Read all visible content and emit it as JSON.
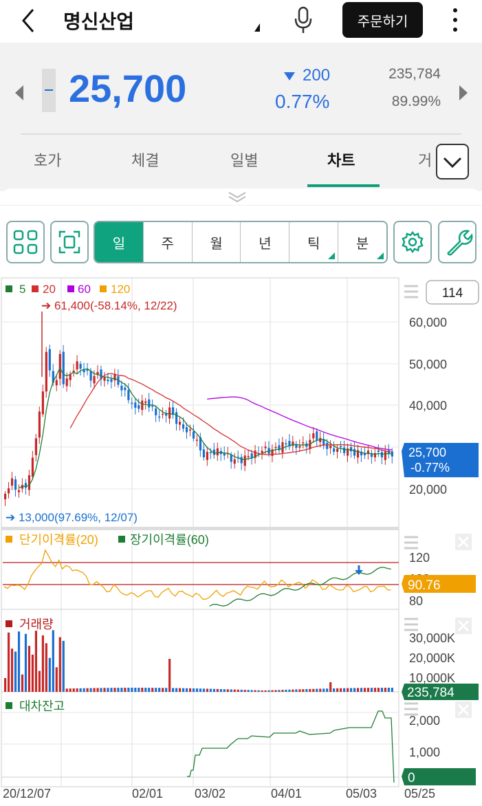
{
  "header": {
    "title": "명신산업",
    "order_label": "주문하기"
  },
  "quote": {
    "price": "25,700",
    "change": "200",
    "change_rate": "0.77%",
    "volume": "235,784",
    "volume_rate": "89.99%"
  },
  "tabs": [
    {
      "label": "호가"
    },
    {
      "label": "체결"
    },
    {
      "label": "일별"
    },
    {
      "label": "차트"
    },
    {
      "label": "거"
    }
  ],
  "active_tab": "차트",
  "periods": [
    "일",
    "주",
    "월",
    "년",
    "틱",
    "분"
  ],
  "chart": {
    "legend": [
      {
        "label": "5",
        "color": "#1e7d32"
      },
      {
        "label": "20",
        "color": "#d32f2f"
      },
      {
        "label": "60",
        "color": "#b000e0"
      },
      {
        "label": "120",
        "color": "#f0a000"
      }
    ],
    "count_box": "114",
    "max_annotation": "61,400(-58.14%, 12/22)",
    "min_annotation": "13,000(97.69%, 12/07)",
    "current_price_label": "25,700",
    "current_rate_label": "-0.77%",
    "price_ticks": [
      "60,000",
      "50,000",
      "40,000",
      "20,000"
    ],
    "disparity": {
      "legend": [
        {
          "label": "단기이격률(20)",
          "color": "#f0a000"
        },
        {
          "label": "장기이격률(60)",
          "color": "#1e7d32"
        }
      ],
      "ticks": [
        "120",
        "100",
        "80"
      ],
      "value_label": "90.76"
    },
    "volume": {
      "legend": "거래량",
      "ticks": [
        "30,000K",
        "20,000K",
        "10,000K"
      ],
      "value_label": "235,784"
    },
    "loan": {
      "legend": "대차잔고",
      "ticks": [
        "2,000",
        "1,000"
      ],
      "value_label": "0"
    },
    "dates": [
      "20/12/07",
      "02/01",
      "03/02",
      "04/01",
      "05/03",
      "05/25"
    ]
  },
  "colors": {
    "accent": "#10a37f",
    "down": "#2b6fe0",
    "up": "#c62828",
    "current_box": "#1a6fd0",
    "disparity_box": "#f0a000",
    "volume_box": "#1a7a4a"
  }
}
